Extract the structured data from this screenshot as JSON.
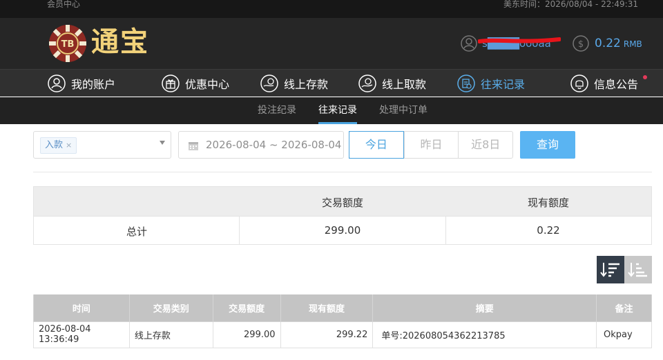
{
  "topbar": {
    "left_text": "会员中心",
    "time_text": "美东时间：2026/08/04 - 22:49:31"
  },
  "brand": {
    "chip_text": "TB",
    "logo_text": "通宝"
  },
  "account": {
    "username": "s████oooaa",
    "balance": "0.22",
    "currency": "RMB"
  },
  "nav": {
    "items": [
      {
        "label": "我的账户",
        "icon": "user-circle-icon"
      },
      {
        "label": "优惠中心",
        "icon": "gift-icon"
      },
      {
        "label": "线上存款",
        "icon": "deposit-icon"
      },
      {
        "label": "线上取款",
        "icon": "withdraw-icon"
      },
      {
        "label": "往来记录",
        "icon": "records-icon"
      },
      {
        "label": "信息公告",
        "icon": "bell-icon"
      }
    ],
    "active": "往来记录",
    "accent": "#5aaeea"
  },
  "subnav": {
    "items": [
      "投注纪录",
      "往来记录",
      "处理中订单"
    ],
    "active": "往来记录"
  },
  "filters": {
    "type_tag": "入款",
    "date_range": "2026-08-04 ~ 2026-08-04",
    "quick_ranges": [
      "今日",
      "昨日",
      "近8日"
    ],
    "quick_active": "今日",
    "query_label": "查询"
  },
  "summary": {
    "headers": [
      "",
      "交易额度",
      "现有额度"
    ],
    "row": [
      "总计",
      "299.00",
      "0.22"
    ]
  },
  "records": {
    "headers": [
      "时间",
      "交易类别",
      "交易额度",
      "现有额度",
      "摘要",
      "备注"
    ],
    "rows": [
      [
        "2026-08-04 13:36:49",
        "线上存款",
        "299.00",
        "299.22",
        "单号:202608054362213785",
        "Okpay"
      ]
    ]
  }
}
